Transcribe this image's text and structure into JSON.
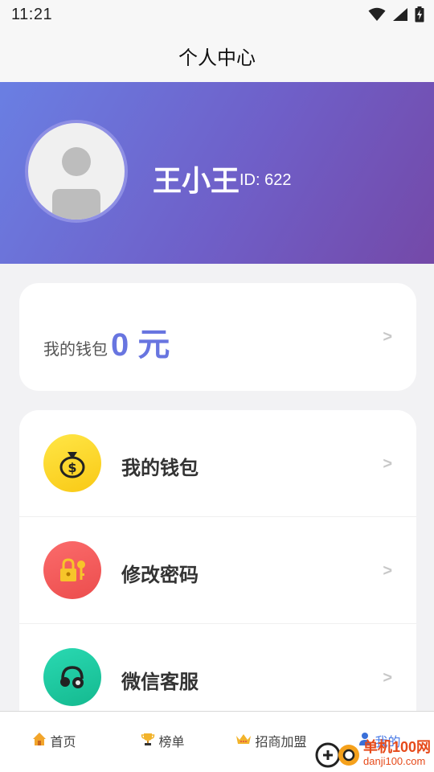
{
  "status_bar": {
    "time": "11:21"
  },
  "header": {
    "title": "个人中心"
  },
  "profile": {
    "name": "王小王",
    "id_text": "ID: 622"
  },
  "wallet_summary": {
    "label": "我的钱包",
    "amount": "0 元",
    "chevron": ">"
  },
  "menu": {
    "items": [
      {
        "label": "我的钱包",
        "icon": "money-bag-icon",
        "color": "#fcd42a",
        "chevron": ">"
      },
      {
        "label": "修改密码",
        "icon": "lock-key-icon",
        "color": "#f25a5a",
        "chevron": ">"
      },
      {
        "label": "微信客服",
        "icon": "headset-icon",
        "color": "#1ec7a0",
        "chevron": ">"
      }
    ]
  },
  "tabs": [
    {
      "label": "首页",
      "icon": "home-icon",
      "active": false
    },
    {
      "label": "榜单",
      "icon": "trophy-icon",
      "active": false
    },
    {
      "label": "招商加盟",
      "icon": "crown-icon",
      "active": false
    },
    {
      "label": "我的",
      "icon": "user-icon",
      "active": true
    }
  ],
  "watermark": {
    "title": "单机100网",
    "url": "danji100.com"
  },
  "colors": {
    "accent": "#6875e0",
    "banner_start": "#6a7fe3",
    "banner_end": "#7449a8",
    "tab_active": "#4a7be6"
  }
}
